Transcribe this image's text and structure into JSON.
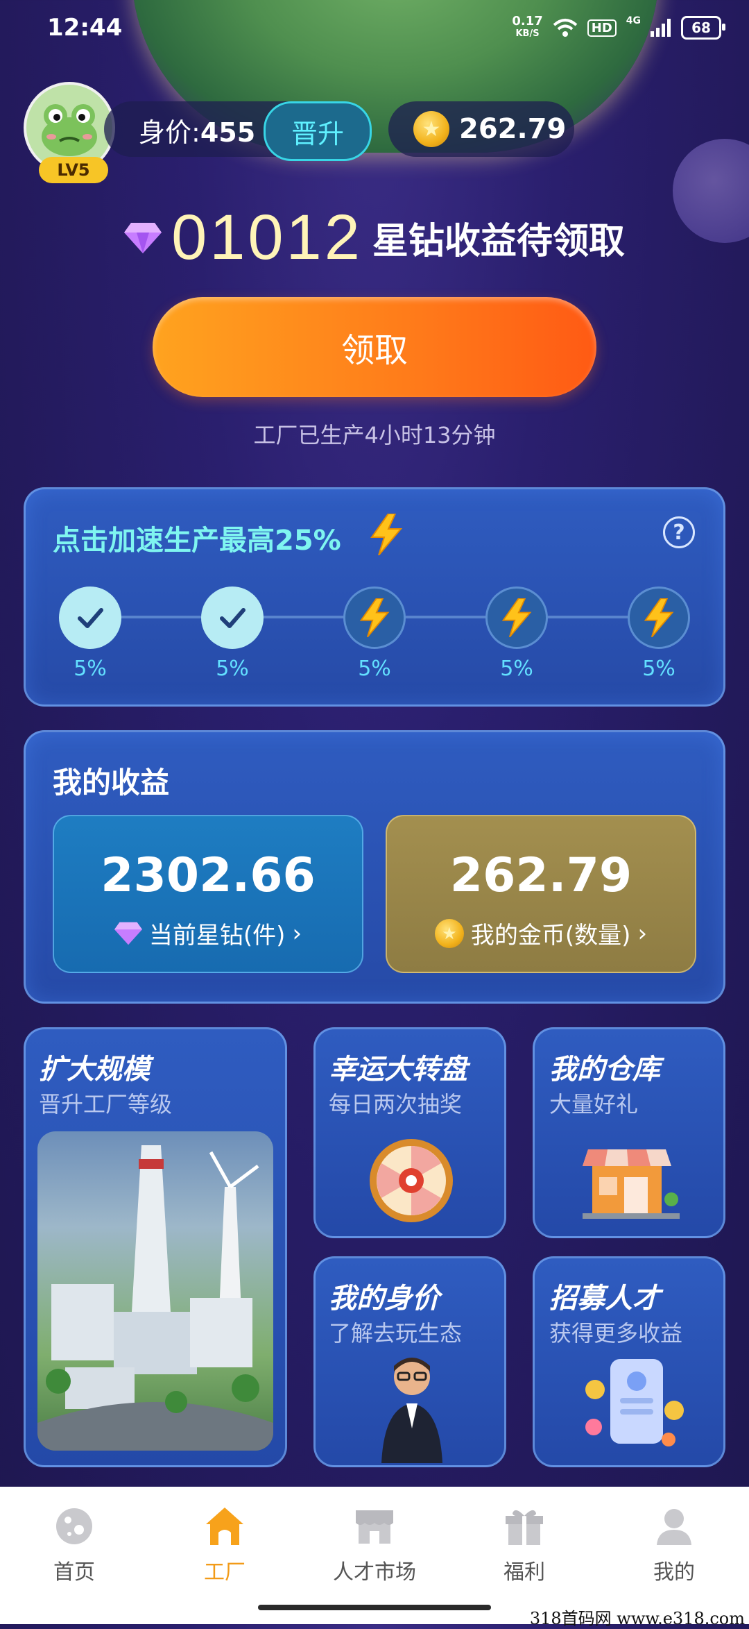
{
  "status_bar": {
    "time": "12:44",
    "net_speed_value": "0.17",
    "net_speed_unit": "KB/S",
    "hd": "HD",
    "signal_label": "4G",
    "battery": "68"
  },
  "profile": {
    "level": "LV5",
    "worth_label": "身价:",
    "worth_value": "455",
    "promote_button": "晋升",
    "coins": "262.79"
  },
  "production": {
    "pending_amount": "01012",
    "pending_label": "星钻收益待领取",
    "claim_button": "领取",
    "produced_time": "工厂已生产4小时13分钟"
  },
  "speedup": {
    "title": "点击加速生产最高25%",
    "help": "?",
    "steps": [
      {
        "state": "done",
        "percent": "5%"
      },
      {
        "state": "done",
        "percent": "5%"
      },
      {
        "state": "todo",
        "percent": "5%"
      },
      {
        "state": "todo",
        "percent": "5%"
      },
      {
        "state": "todo",
        "percent": "5%"
      }
    ]
  },
  "income": {
    "title": "我的收益",
    "diamonds_value": "2302.66",
    "diamonds_label": "当前星钻(件)",
    "coins_value": "262.79",
    "coins_label": "我的金币(数量)"
  },
  "features": {
    "expand": {
      "title": "扩大规模",
      "subtitle": "晋升工厂等级"
    },
    "wheel": {
      "title": "幸运大转盘",
      "subtitle": "每日两次抽奖"
    },
    "store": {
      "title": "我的仓库",
      "subtitle": "大量好礼"
    },
    "worth": {
      "title": "我的身价",
      "subtitle": "了解去玩生态"
    },
    "recruit": {
      "title": "招募人才",
      "subtitle": "获得更多收益"
    }
  },
  "nav": {
    "items": [
      {
        "label": "首页",
        "icon": "home-planet-icon"
      },
      {
        "label": "工厂",
        "icon": "factory-house-icon",
        "active": true
      },
      {
        "label": "人才市场",
        "icon": "market-icon"
      },
      {
        "label": "福利",
        "icon": "gift-icon"
      },
      {
        "label": "我的",
        "icon": "user-icon"
      }
    ]
  },
  "watermark": "318首码网 www.e318.com",
  "colors": {
    "accent_orange": "#ff7a1a",
    "cyan": "#5ff0ff",
    "nav_active": "#f29b18"
  }
}
